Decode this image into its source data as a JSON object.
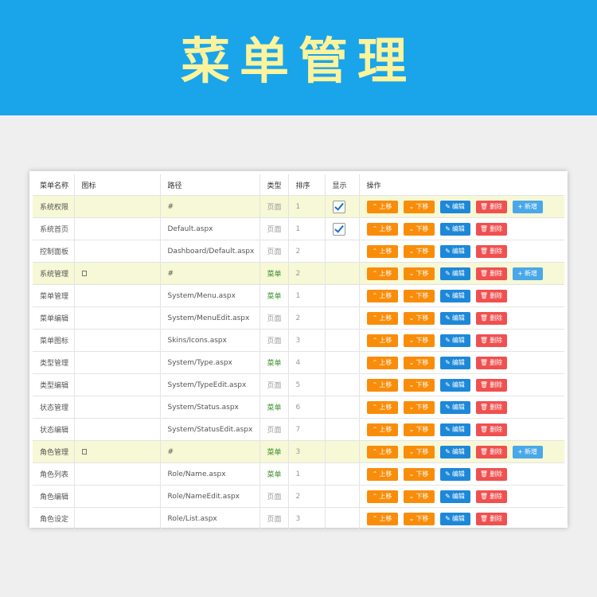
{
  "banner": {
    "title": "菜单管理"
  },
  "table": {
    "columns": [
      "菜单名称",
      "图标",
      "路径",
      "类型",
      "排序",
      "显示",
      "操作"
    ],
    "actions": {
      "up": "上移",
      "down": "下移",
      "edit": "编辑",
      "delete": "删除",
      "add": "新增"
    },
    "rows": [
      {
        "name": "系统权限",
        "icon": "",
        "path": "#",
        "type": "页面",
        "sort": "1",
        "shown": true,
        "top": true,
        "add": true
      },
      {
        "name": "系统首页",
        "icon": "",
        "path": "Default.aspx",
        "type": "页面",
        "sort": "1",
        "shown": true,
        "top": false,
        "add": false
      },
      {
        "name": "控制面板",
        "icon": "",
        "path": "Dashboard/Default.aspx",
        "type": "页面",
        "sort": "2",
        "shown": false,
        "top": false,
        "add": false
      },
      {
        "name": "系统管理",
        "icon": "square",
        "path": "#",
        "type": "菜单",
        "sort": "2",
        "shown": false,
        "top": true,
        "add": true
      },
      {
        "name": "菜单管理",
        "icon": "",
        "path": "System/Menu.aspx",
        "type": "菜单",
        "sort": "1",
        "shown": false,
        "top": false,
        "add": false
      },
      {
        "name": "菜单编辑",
        "icon": "",
        "path": "System/MenuEdit.aspx",
        "type": "页面",
        "sort": "2",
        "shown": false,
        "top": false,
        "add": false
      },
      {
        "name": "菜单图标",
        "icon": "",
        "path": "Skins/Icons.aspx",
        "type": "页面",
        "sort": "3",
        "shown": false,
        "top": false,
        "add": false
      },
      {
        "name": "类型管理",
        "icon": "",
        "path": "System/Type.aspx",
        "type": "菜单",
        "sort": "4",
        "shown": false,
        "top": false,
        "add": false
      },
      {
        "name": "类型编辑",
        "icon": "",
        "path": "System/TypeEdit.aspx",
        "type": "页面",
        "sort": "5",
        "shown": false,
        "top": false,
        "add": false
      },
      {
        "name": "状态管理",
        "icon": "",
        "path": "System/Status.aspx",
        "type": "菜单",
        "sort": "6",
        "shown": false,
        "top": false,
        "add": false
      },
      {
        "name": "状态编辑",
        "icon": "",
        "path": "System/StatusEdit.aspx",
        "type": "页面",
        "sort": "7",
        "shown": false,
        "top": false,
        "add": false
      },
      {
        "name": "角色管理",
        "icon": "square",
        "path": "#",
        "type": "菜单",
        "sort": "3",
        "shown": false,
        "top": true,
        "add": true
      },
      {
        "name": "角色列表",
        "icon": "",
        "path": "Role/Name.aspx",
        "type": "菜单",
        "sort": "1",
        "shown": false,
        "top": false,
        "add": false
      },
      {
        "name": "角色编辑",
        "icon": "",
        "path": "Role/NameEdit.aspx",
        "type": "页面",
        "sort": "2",
        "shown": false,
        "top": false,
        "add": false
      },
      {
        "name": "角色设定",
        "icon": "",
        "path": "Role/List.aspx",
        "type": "页面",
        "sort": "3",
        "shown": false,
        "top": false,
        "add": false
      }
    ]
  },
  "colors": {
    "banner": "#1aa4ea",
    "title": "#fbf39d",
    "orange": "#f98d0a",
    "blue": "#1e88d8",
    "red": "#f05050",
    "lightblue": "#4aa8e8",
    "highlight": "#f6f8d6",
    "menu_type": "#3c8f2b"
  }
}
